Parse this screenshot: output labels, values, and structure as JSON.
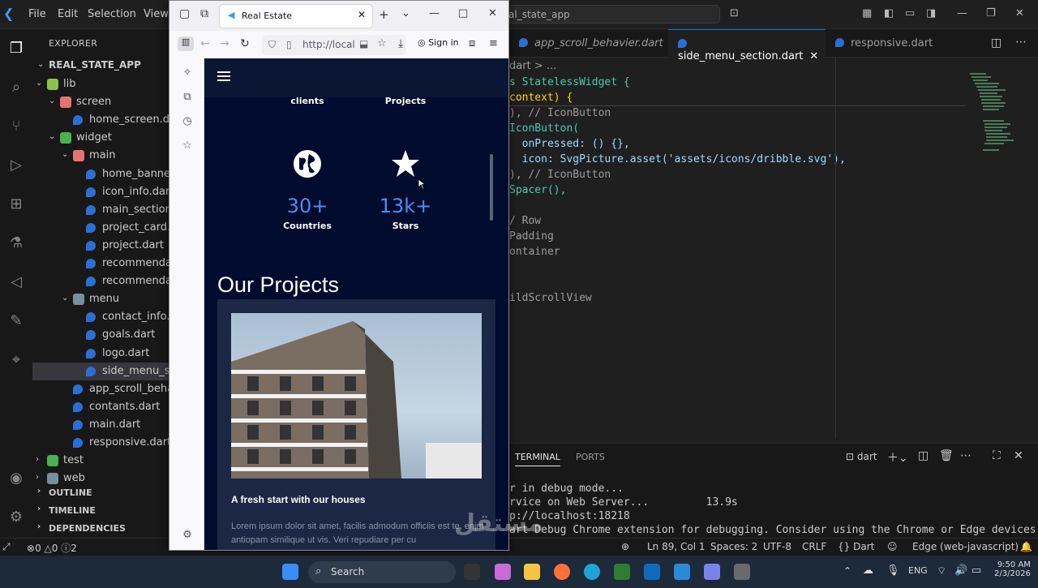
{
  "vscode": {
    "menu": [
      "File",
      "Edit",
      "Selection",
      "View"
    ],
    "command_center": "al_state_app",
    "explorer": {
      "title": "EXPLORER",
      "project": "REAL_STATE_APP",
      "tree": [
        {
          "label": "lib",
          "type": "folder-lib"
        },
        {
          "label": "screen",
          "type": "folder-red"
        },
        {
          "label": "home_screen.dart",
          "type": "dart"
        },
        {
          "label": "widget",
          "type": "folder-green"
        },
        {
          "label": "main",
          "type": "folder-red"
        },
        {
          "label": "home_banner.da",
          "type": "dart"
        },
        {
          "label": "icon_info.dart",
          "type": "dart"
        },
        {
          "label": "main_section.da",
          "type": "dart"
        },
        {
          "label": "project_card.dar",
          "type": "dart"
        },
        {
          "label": "project.dart",
          "type": "dart"
        },
        {
          "label": "recommendatio",
          "type": "dart"
        },
        {
          "label": "recommendatio",
          "type": "dart"
        },
        {
          "label": "menu",
          "type": "folder-plain"
        },
        {
          "label": "contact_info.dar",
          "type": "dart"
        },
        {
          "label": "goals.dart",
          "type": "dart"
        },
        {
          "label": "logo.dart",
          "type": "dart"
        },
        {
          "label": "side_menu_secti",
          "type": "dart"
        },
        {
          "label": "app_scroll_behavie",
          "type": "dart"
        },
        {
          "label": "contants.dart",
          "type": "dart"
        },
        {
          "label": "main.dart",
          "type": "dart"
        },
        {
          "label": "responsive.dart",
          "type": "dart"
        },
        {
          "label": "test",
          "type": "folder-green"
        },
        {
          "label": "web",
          "type": "folder-plain"
        }
      ],
      "sections": [
        "OUTLINE",
        "TIMELINE",
        "DEPENDENCIES"
      ]
    },
    "tabs": [
      "app_scroll_behavier.dart",
      "side_menu_section.dart",
      "responsive.dart"
    ],
    "breadcrumb": "dart > ...",
    "code_lines": [
      "s StatelessWidget {",
      "context) {",
      "), // IconButton",
      "IconButton(",
      "  onPressed: () {},",
      "  icon: SvgPicture.asset('assets/icons/dribble.svg'),",
      "), // IconButton",
      "Spacer(),",
      "",
      "/ Row",
      "Padding",
      "ontainer",
      "",
      "",
      "ildScrollView"
    ],
    "panel": {
      "tabs": [
        "TERMINAL",
        "PORTS"
      ],
      "terminal_name": "dart",
      "lines": [
        "r in debug mode...",
        "rvice on Web Server...         13.9s",
        "p://localhost:18218",
        "art Debug Chrome extension for debugging. Consider using the Chrome or Edge devices fo"
      ]
    },
    "status": {
      "errors": "0",
      "warnings": "0",
      "info": "0",
      "info2": "2",
      "position": "Ln 89, Col 1",
      "spaces": "Spaces: 2",
      "encoding": "UTF-8",
      "eol": "CRLF",
      "language": "Dart",
      "device": "Edge (web-javascript)"
    }
  },
  "browser": {
    "tab_title": "Real Estate",
    "url": "http://local",
    "sign_in": "Sign in"
  },
  "web": {
    "top_labels": [
      "clients",
      "Projects"
    ],
    "stats": [
      {
        "value": "30+",
        "label": "Countries",
        "icon": "globe-icon"
      },
      {
        "value": "13k+",
        "label": "Stars",
        "icon": "star-icon"
      }
    ],
    "section_title": "Our Projects",
    "card": {
      "title": "A fresh start with our houses",
      "description": "Lorem ipsum dolor sit amet, facilis admodum officiis est te, enim antiopam similique ut vis. Veri repudiare per cu"
    }
  },
  "taskbar": {
    "search": "Search",
    "lang": "ENG",
    "time": "9:50 AM",
    "date": "2/3/2026"
  },
  "watermark": "مستقل"
}
